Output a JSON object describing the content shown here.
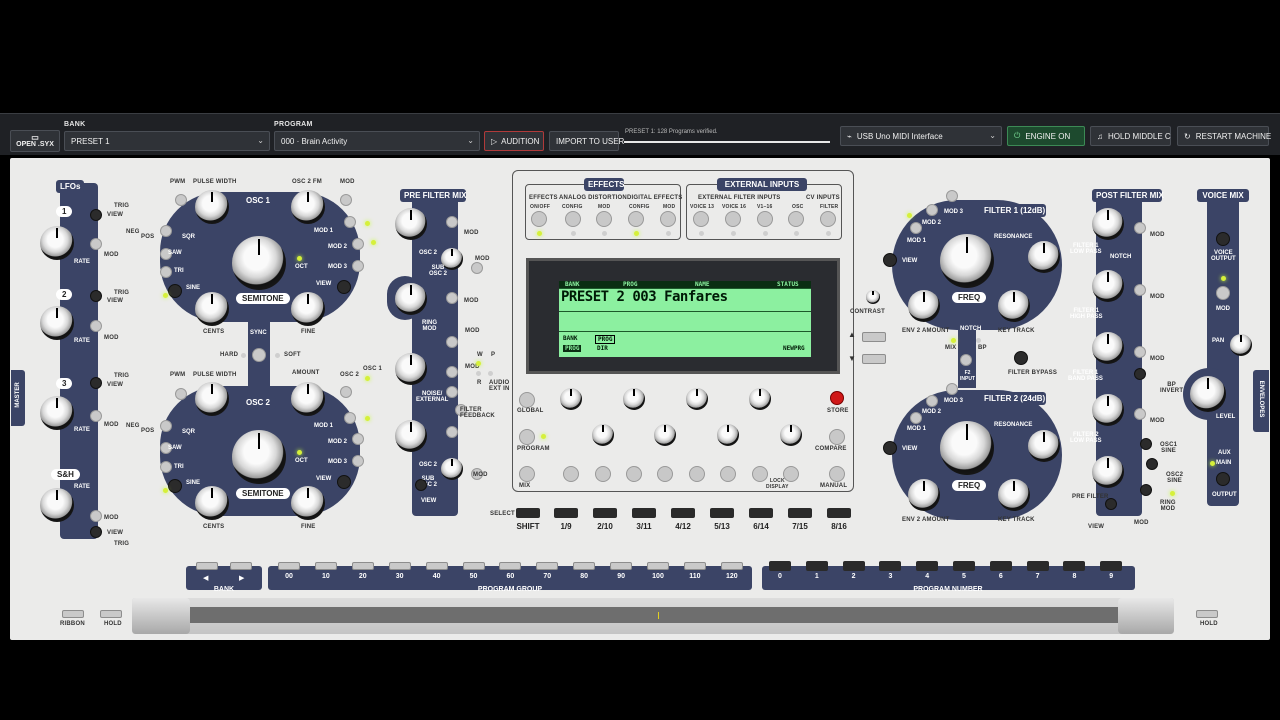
{
  "toolbar": {
    "open_syx": "OPEN .SYX",
    "bank_label": "BANK",
    "bank_value": "PRESET 1",
    "program_label": "PROGRAM",
    "program_value": "000 · Brain Activity",
    "audition": "AUDITION",
    "import_user": "IMPORT TO USER",
    "status_msg": "PRESET 1: 128 Programs verified.",
    "midi_interface": "USB Uno MIDI Interface",
    "engine_on": "ENGINE ON",
    "hold_middle_c": "HOLD MIDDLE C",
    "restart_machine": "RESTART MACHINE"
  },
  "lfo": {
    "title": "LFOs",
    "n1": "1",
    "n2": "2",
    "n3": "3",
    "sh": "S&H",
    "trig": "TRIG",
    "view": "VIEW",
    "rate": "RATE",
    "mod": "MOD",
    "neg": "NEG",
    "pos": "POS"
  },
  "osc1": {
    "title": "OSC 1",
    "pwm": "PWM",
    "pulse_width": "PULSE WIDTH",
    "osc2fm": "OSC 2 FM",
    "mod": "MOD",
    "sqr": "SQR",
    "saw": "SAW",
    "tri": "TRI",
    "sine": "SINE",
    "semitone": "SEMITONE",
    "cents": "CENTS",
    "fine": "FINE",
    "oct": "OCT",
    "mod1": "MOD 1",
    "mod2": "MOD 2",
    "mod3": "MOD 3",
    "view": "VIEW"
  },
  "sync": {
    "sync": "SYNC",
    "hard": "HARD",
    "soft": "SOFT"
  },
  "osc2": {
    "title": "OSC 2",
    "pwm": "PWM",
    "pulse_width": "PULSE WIDTH",
    "amount": "AMOUNT",
    "osc2": "OSC 2",
    "osc1": "OSC 1",
    "sqr": "SQR",
    "saw": "SAW",
    "tri": "TRI",
    "sine": "SINE",
    "semitone": "SEMITONE",
    "cents": "CENTS",
    "fine": "FINE",
    "oct": "OCT",
    "mod1": "MOD 1",
    "mod2": "MOD 2",
    "mod3": "MOD 3",
    "view": "VIEW"
  },
  "prefilter": {
    "title": "PRE FILTER MIX",
    "osc2": "OSC 2",
    "sub_osc2": "SUB\nOSC 2",
    "ring_mod": "RING\nMOD",
    "noise": "NOISE/\nEXTERNAL",
    "filter_feedback": "FILTER\nFEEDBACK",
    "audio_ext": "AUDIO\nEXT IN",
    "osc2b": "OSC 2",
    "sub_osc2b": "SUB\nOSC 2",
    "view": "VIEW",
    "mod": "MOD",
    "w": "W",
    "p": "P",
    "r": "R"
  },
  "effects": {
    "title": "EFFECTS",
    "onoff": "ON/OFF",
    "effects": "EFFECTS",
    "analog": "ANALOG DISTORTION",
    "digital": "DIGITAL EFFECTS",
    "config": "CONFIG",
    "mod": "MOD"
  },
  "external": {
    "title": "EXTERNAL INPUTS",
    "filter_inputs": "EXTERNAL FILTER INPUTS",
    "cv_inputs": "CV INPUTS",
    "voice13": "VOICE 13",
    "voice16": "VOICE 16",
    "v116": "V1–16",
    "osc": "OSC",
    "filter": "FILTER"
  },
  "lcd": {
    "h_bank": "BANK",
    "h_prog": "PROG",
    "h_name": "NAME",
    "h_status": "STATUS",
    "title": "PRESET 2 003 Fanfares",
    "bank_soft": "BANK",
    "prog_soft": "PROG",
    "prog2": "PROG",
    "dir": "DIR",
    "newprg": "NEWPRG"
  },
  "controls": {
    "global": "GLOBAL",
    "program": "PROGRAM",
    "mix": "MIX",
    "store": "STORE",
    "compare": "COMPARE",
    "manual": "MANUAL",
    "contrast": "CONTRAST",
    "lock_display": "LOCK\nDISPLAY",
    "select": "SELECT",
    "shift": "SHIFT",
    "b1": "1/9",
    "b2": "2/10",
    "b3": "3/11",
    "b4": "4/12",
    "b5": "5/13",
    "b6": "6/14",
    "b7": "7/15",
    "b8": "8/16"
  },
  "filter1": {
    "title": "FILTER 1 (12dB)",
    "mod1": "MOD 1",
    "mod2": "MOD 2",
    "mod3": "MOD 3",
    "view": "VIEW",
    "freq": "FREQ",
    "resonance": "RESONANCE",
    "env2": "ENV 2 AMOUNT",
    "key_track": "KEY TRACK",
    "notch": "NOTCH",
    "mix": "MIX",
    "bp": "BP",
    "f2input": "F2\nINPUT",
    "bypass": "FILTER BYPASS"
  },
  "filter2": {
    "title": "FILTER 2 (24dB)",
    "mod1": "MOD 1",
    "mod2": "MOD 2",
    "mod3": "MOD 3",
    "view": "VIEW",
    "freq": "FREQ",
    "resonance": "RESONANCE",
    "env2": "ENV 2 AMOUNT",
    "key_track": "KEY TRACK"
  },
  "postfilter": {
    "title": "POST FILTER MIX",
    "f1lp": "FILTER 1\nLOW PASS",
    "f1hp": "FILTER 1\nHIGH PASS",
    "f1bp": "FILTER 1\nBAND PASS",
    "f2lp": "FILTER 2\nLOW PASS",
    "prefilter": "PRE FILTER",
    "notch": "NOTCH",
    "bpinvert": "BP\nINVERT",
    "osc1sine": "OSC1\nSINE",
    "osc2sine": "OSC2\nSINE",
    "ringmod": "RING\nMOD",
    "mod": "MOD",
    "view": "VIEW"
  },
  "voicemix": {
    "title": "VOICE MIX",
    "voice_output": "VOICE\nOUTPUT",
    "mod": "MOD",
    "pan": "PAN",
    "level": "LEVEL",
    "aux": "AUX",
    "main": "MAIN",
    "output": "OUTPUT"
  },
  "side": {
    "master": "MASTER",
    "envelopes": "ENVELOPES"
  },
  "bottom": {
    "bank": "BANK",
    "program_group": "PROGRAM GROUP",
    "program_number": "PROGRAM NUMBER",
    "groups": [
      "00",
      "10",
      "20",
      "30",
      "40",
      "50",
      "60",
      "70",
      "80",
      "90",
      "100",
      "110",
      "120"
    ],
    "numbers": [
      "0",
      "1",
      "2",
      "3",
      "4",
      "5",
      "6",
      "7",
      "8",
      "9"
    ],
    "ribbon": "RIBBON",
    "hold": "HOLD",
    "hold_r": "HOLD"
  },
  "colors": {
    "panel_navy": "#3b4466",
    "led_on": "#d6f03a",
    "lcd": "#8cf0a0",
    "engine_on": "#1d4a2e"
  }
}
